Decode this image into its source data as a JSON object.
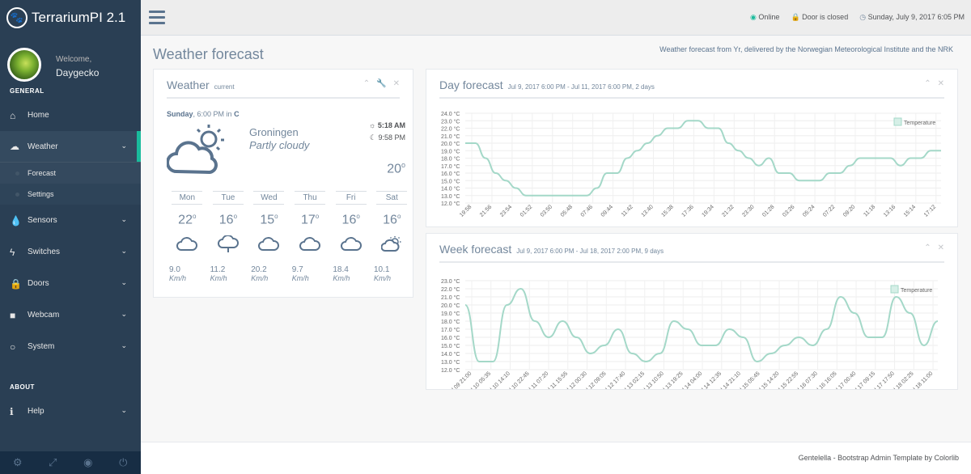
{
  "app": {
    "title": "TerrariumPI 2.1"
  },
  "profile": {
    "welcome": "Welcome,",
    "name": "Daygecko"
  },
  "sidebar": {
    "general_label": "GENERAL",
    "about_label": "ABOUT",
    "items": [
      {
        "label": "Home",
        "icon": "home-icon"
      },
      {
        "label": "Weather",
        "icon": "cloud-icon"
      },
      {
        "label": "Sensors",
        "icon": "tint-icon"
      },
      {
        "label": "Switches",
        "icon": "bolt-icon"
      },
      {
        "label": "Doors",
        "icon": "lock-icon"
      },
      {
        "label": "Webcam",
        "icon": "video-icon"
      },
      {
        "label": "System",
        "icon": "lightbulb-icon"
      },
      {
        "label": "Help",
        "icon": "info-icon"
      }
    ],
    "sub_items": [
      {
        "label": "Forecast"
      },
      {
        "label": "Settings"
      }
    ]
  },
  "topbar": {
    "online": "Online",
    "door": "Door is closed",
    "datetime": "Sunday, July 9, 2017 6:05 PM"
  },
  "page": {
    "title": "Weather forecast",
    "credit": "Weather forecast from Yr, delivered by the Norwegian Meteorological Institute and the NRK"
  },
  "weather_panel": {
    "title": "Weather",
    "subtitle": "current",
    "day_label": "Sunday",
    "time": ", 6:00 PM",
    "in_label": " in ",
    "unit": "C",
    "city": "Groningen",
    "description": "Partly cloudy",
    "sunrise": "5:18 AM",
    "sunset": "9:58 PM",
    "temperature": "20",
    "days": [
      {
        "name": "Mon",
        "temp": "22",
        "icon": "cloud-icon",
        "wind": "9.0",
        "unit": "Km/h"
      },
      {
        "name": "Tue",
        "temp": "16",
        "icon": "rain-icon",
        "wind": "11.2",
        "unit": "Km/h"
      },
      {
        "name": "Wed",
        "temp": "15",
        "icon": "cloud-icon",
        "wind": "20.2",
        "unit": "Km/h"
      },
      {
        "name": "Thu",
        "temp": "17",
        "icon": "cloud-icon",
        "wind": "9.7",
        "unit": "Km/h"
      },
      {
        "name": "Fri",
        "temp": "16",
        "icon": "cloud-icon",
        "wind": "18.4",
        "unit": "Km/h"
      },
      {
        "name": "Sat",
        "temp": "16",
        "icon": "partly-sunny-icon",
        "wind": "10.1",
        "unit": "Km/h"
      }
    ]
  },
  "day_panel": {
    "title": "Day forecast",
    "subtitle": "Jul 9, 2017 6:00 PM - Jul 11, 2017 6:00 PM, 2 days"
  },
  "week_panel": {
    "title": "Week forecast",
    "subtitle": "Jul 9, 2017 6:00 PM - Jul 18, 2017 2:00 PM, 9 days"
  },
  "footer": {
    "text": "Gentelella - Bootstrap Admin Template by Colorlib"
  },
  "colors": {
    "accent": "#1abb9c",
    "line": "#a4d8c8",
    "sidebar": "#2a3f54"
  },
  "chart_data": [
    {
      "type": "line",
      "categories": [
        "19:58",
        "21:56",
        "23:54",
        "01:52",
        "03:50",
        "05:48",
        "07:46",
        "09:44",
        "11:42",
        "13:40",
        "15:38",
        "17:36",
        "19:34",
        "21:32",
        "23:30",
        "01:28",
        "03:26",
        "05:24",
        "07:22",
        "09:20",
        "11:18",
        "13:16",
        "15:14",
        "17:12"
      ],
      "series": [
        {
          "name": "Temperature",
          "values": [
            20,
            20,
            18,
            16,
            15,
            14,
            13,
            13,
            13,
            13,
            13,
            13,
            13,
            14,
            16,
            16,
            18,
            19,
            20,
            21,
            22,
            22,
            23,
            23,
            22,
            22,
            20,
            19,
            18,
            17,
            18,
            16,
            16,
            15,
            15,
            15,
            16,
            16,
            17,
            18,
            18,
            18,
            18,
            17,
            18,
            18,
            19,
            19
          ]
        }
      ],
      "yticks": [
        "24.0 °C",
        "23.0 °C",
        "22.0 °C",
        "21.0 °C",
        "20.0 °C",
        "19.0 °C",
        "18.0 °C",
        "17.0 °C",
        "16.0 °C",
        "15.0 °C",
        "14.0 °C",
        "13.0 °C",
        "12.0 °C"
      ],
      "ylim": [
        12,
        24
      ],
      "legend": "top-right",
      "grid": true
    },
    {
      "type": "line",
      "categories": [
        "Jul 09 21:00",
        "Jul 10 05:35",
        "Jul 10 14:10",
        "Jul 10 22:45",
        "Jul 11 07:20",
        "Jul 11 15:55",
        "Jul 12 00:30",
        "Jul 12 09:05",
        "Jul 12 17:40",
        "Jul 13 02:15",
        "Jul 13 10:50",
        "Jul 13 19:25",
        "Jul 14 04:00",
        "Jul 14 12:35",
        "Jul 14 21:10",
        "Jul 15 05:45",
        "Jul 15 14:20",
        "Jul 15 22:55",
        "Jul 16 07:30",
        "Jul 16 16:05",
        "Jul 17 00:40",
        "Jul 17 09:15",
        "Jul 17 17:50",
        "Jul 18 02:25",
        "Jul 18 11:00"
      ],
      "series": [
        {
          "name": "Temperature",
          "values": [
            20,
            13,
            13,
            20,
            22,
            18,
            16,
            18,
            16,
            14,
            15,
            17,
            14,
            13,
            14,
            18,
            17,
            15,
            15,
            17,
            16,
            13,
            14,
            15,
            16,
            15,
            17,
            21,
            19,
            16,
            16,
            21,
            19,
            15,
            18
          ]
        }
      ],
      "yticks": [
        "23.0 °C",
        "22.0 °C",
        "21.0 °C",
        "20.0 °C",
        "19.0 °C",
        "18.0 °C",
        "17.0 °C",
        "16.0 °C",
        "15.0 °C",
        "14.0 °C",
        "13.0 °C",
        "12.0 °C"
      ],
      "ylim": [
        12,
        23
      ],
      "legend": "top-right",
      "grid": true
    }
  ]
}
